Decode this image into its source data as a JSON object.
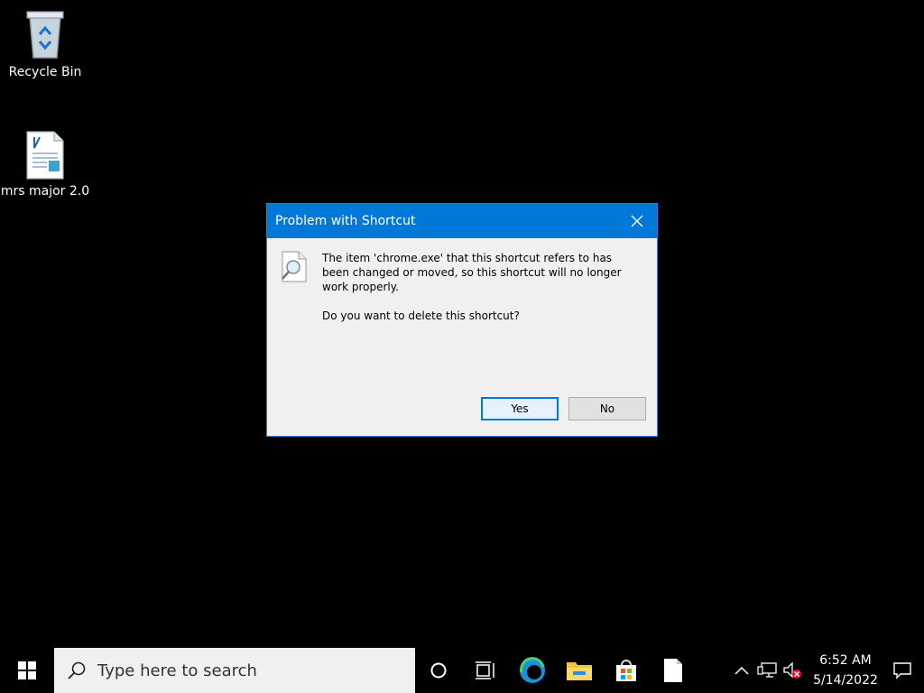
{
  "desktop": {
    "icons": [
      {
        "label": "Recycle Bin",
        "icon": "recycle-bin-icon"
      },
      {
        "label": "mrs major 2.0",
        "icon": "document-icon"
      }
    ]
  },
  "dialog": {
    "title": "Problem with Shortcut",
    "icon": "magnifier-document-icon",
    "message": "The item 'chrome.exe' that this shortcut refers to has been changed or moved, so this shortcut will no longer work properly.",
    "question": "Do you want to delete this shortcut?",
    "yes_label": "Yes",
    "no_label": "No"
  },
  "taskbar": {
    "search_placeholder": "Type here to search",
    "apps": [
      "cortana-icon",
      "task-view-icon",
      "edge-icon",
      "file-explorer-icon",
      "store-icon",
      "document-icon"
    ],
    "clock_time": "6:52 AM",
    "clock_date": "5/14/2022"
  },
  "colors": {
    "titlebar": "#0078d7",
    "desktop": "#000000",
    "dialog_bg": "#f0f0f0"
  }
}
